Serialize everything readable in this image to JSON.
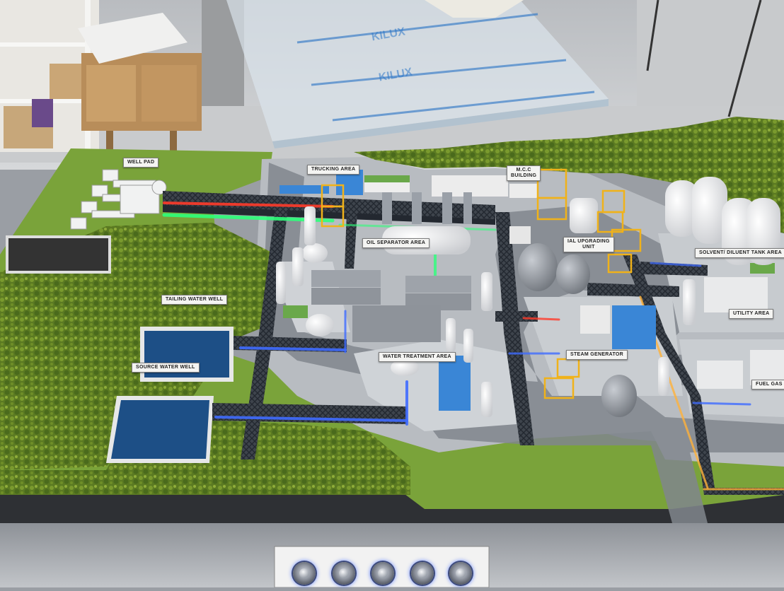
{
  "scene": {
    "description_labels": {
      "well_pad": "WELL PAD",
      "trucking_area": "TRUCKING AREA",
      "mcc_building_line1": "M.C.C",
      "mcc_building_line2": "BUILDING",
      "oil_separator_area": "OIL SEPARATOR AREA",
      "partial_upgrading_unit_line1": "IAL UPGRADING",
      "partial_upgrading_unit_line2": "UNIT",
      "solvent_diluent_tank_area": "SOLVENT/ DILUENT TANK AREA",
      "tailing_water_well": "TAILING WATER WELL",
      "utility_area": "UTILITY AREA",
      "water_treatment_area": "WATER TREATMENT AREA",
      "steam_generator": "STEAM GENERATOR",
      "source_water_well": "SOURCE WATER WELL",
      "fuel_gas": "FUEL GAS"
    },
    "watermark": [
      "KILUX",
      "KILUX"
    ],
    "control_panel": {
      "button_count": 5
    },
    "colors": {
      "grass": "#7aa33a",
      "shrub": "#5f7a1f",
      "road": "#7f858c",
      "platform": "#c7cbcf",
      "water": "#1d4f86",
      "pipe_glow_red": "#ff3b2a",
      "pipe_glow_green": "#2dff7a",
      "pipe_glow_blue": "#3f6bff",
      "pipe_glow_orange": "#ffb23a",
      "tower_yellow": "#f0b21a"
    }
  }
}
